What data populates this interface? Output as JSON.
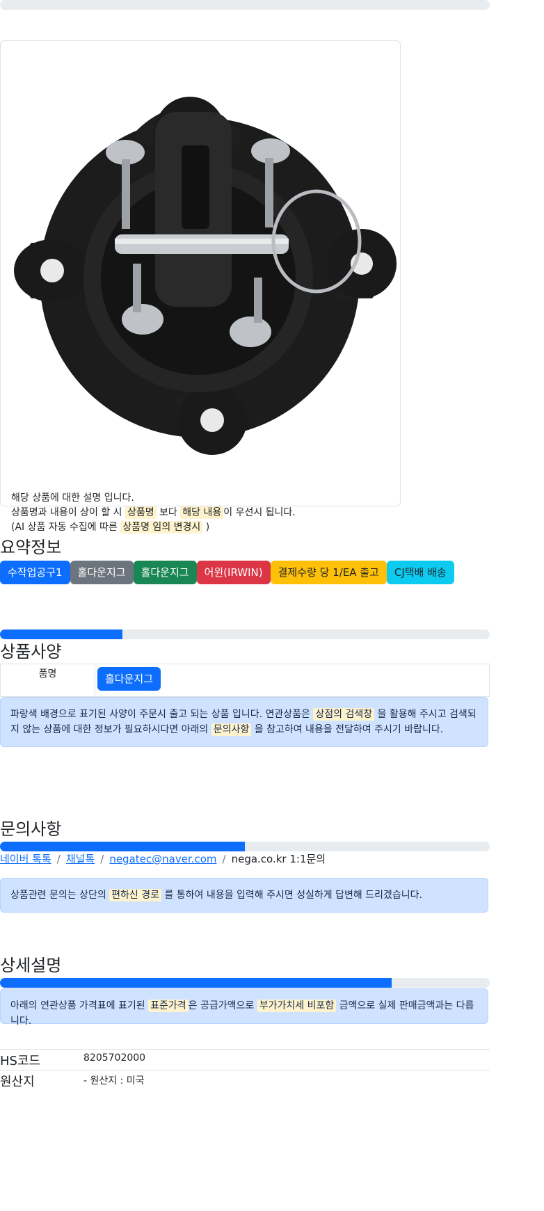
{
  "card": {
    "image_alt": "holddown jig product photo",
    "lines": [
      {
        "parts": [
          "해당 상품에 대한 설명 입니다."
        ]
      },
      {
        "parts": [
          "상품명과 내용이 상이 할 시 ",
          "상품명",
          " 보다 ",
          "해당 내용",
          "이 우선시 됩니다."
        ]
      },
      {
        "parts": [
          "(AI 상품 자동 수집에 따른 ",
          "상품명 임의 변경시",
          " )"
        ]
      }
    ]
  },
  "summary": {
    "heading": "요약정보",
    "tags": [
      {
        "label": "수작업공구1",
        "color": "#0d6efd",
        "text": "#ffffff"
      },
      {
        "label": "홀다운지그",
        "color": "#6c757d",
        "text": "#ffffff"
      },
      {
        "label": "홀다운지그",
        "color": "#198754",
        "text": "#ffffff"
      },
      {
        "label": "어윈(IRWIN)",
        "color": "#dc3545",
        "text": "#ffffff"
      },
      {
        "label": "결제수량 당 1/EA 출고",
        "color": "#ffc107",
        "text": "#212529"
      },
      {
        "label": "CJ택배 배송",
        "color": "#0dcaf0",
        "text": "#212529"
      }
    ]
  },
  "spec": {
    "heading": "상품사양",
    "progress": 0.25,
    "key": "품명",
    "value": "홀다운지그",
    "notice_parts": [
      "파랑색 배경으로 표기된 사양이 주문시 출고 되는 상품 입니다. 연관상품은 ",
      "상점의 검색창",
      " 을 활용해 주시고 검색되지 않는 상품에 대한 정보가 필요하시다면 아래의 ",
      "문의사항",
      " 을 참고하여 내용을 전달하여 주시기 바랍니다."
    ]
  },
  "inquiry": {
    "heading": "문의사항",
    "progress": 0.5,
    "links": [
      "네이버 톡톡",
      "채널톡",
      "negatec@naver.com"
    ],
    "plain": "nega.co.kr 1:1문의",
    "notice_parts": [
      "상품관련 문의는 상단의 ",
      "편하신 경로",
      " 를 통하여 내용을 입력해 주시면 성실하게 답변해 드리겠습니다."
    ]
  },
  "detail": {
    "heading": "상세설명",
    "progress": 0.8,
    "notice_parts": [
      "아래의 연관상품 가격표에 표기된 ",
      "표준가격",
      "은 공급가액으로 ",
      "부가가치세 비포함",
      " 금액으로 실제 판매금액과는 다릅니다."
    ]
  },
  "info": [
    {
      "key": "HS코드",
      "value": "8205702000"
    },
    {
      "key": "원산지",
      "value": "- 원산지 : 미국"
    }
  ],
  "colors": {
    "primary": "#0d6efd",
    "highlight": "#fff3cd",
    "alert_bg": "#cfe2ff"
  }
}
